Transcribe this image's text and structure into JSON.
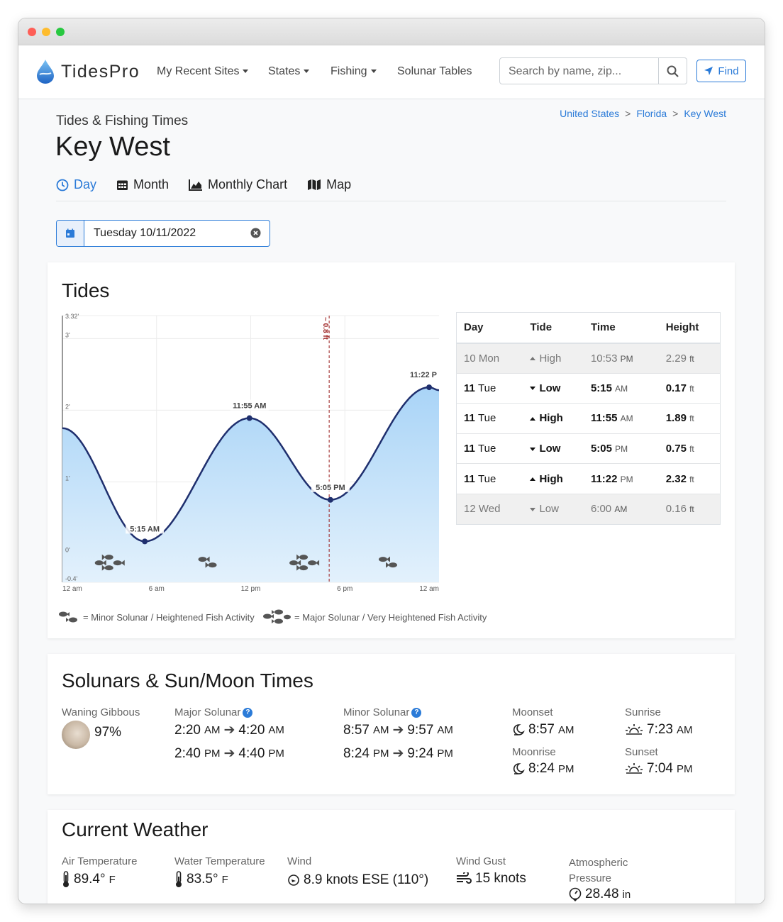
{
  "brand": {
    "name": "TidesPro"
  },
  "nav": {
    "items": [
      "My Recent Sites",
      "States",
      "Fishing",
      "Solunar Tables"
    ],
    "search_placeholder": "Search by name, zip...",
    "find_label": "Find"
  },
  "header": {
    "subtitle": "Tides & Fishing Times",
    "title": "Key West",
    "breadcrumb": [
      "United States",
      "Florida",
      "Key West"
    ]
  },
  "tabs": [
    {
      "label": "Day",
      "icon": "clock-icon",
      "active": true
    },
    {
      "label": "Month",
      "icon": "calendar-grid-icon"
    },
    {
      "label": "Monthly Chart",
      "icon": "area-chart-icon"
    },
    {
      "label": "Map",
      "icon": "map-icon"
    }
  ],
  "date": {
    "value": "Tuesday 10/11/2022"
  },
  "tides": {
    "title": "Tides",
    "table": {
      "headers": [
        "Day",
        "Tide",
        "Time",
        "Height"
      ],
      "rows": [
        {
          "day": "10 Mon",
          "tide": "High",
          "time": "10:53",
          "ampm": "PM",
          "height": "2.29",
          "unit": "ft",
          "style": "dim"
        },
        {
          "day_num": "11",
          "day_name": "Tue",
          "tide": "Low",
          "time": "5:15",
          "ampm": "AM",
          "height": "0.17",
          "unit": "ft",
          "style": "cur"
        },
        {
          "day_num": "11",
          "day_name": "Tue",
          "tide": "High",
          "time": "11:55",
          "ampm": "AM",
          "height": "1.89",
          "unit": "ft",
          "style": "cur"
        },
        {
          "day_num": "11",
          "day_name": "Tue",
          "tide": "Low",
          "time": "5:05",
          "ampm": "PM",
          "height": "0.75",
          "unit": "ft",
          "style": "cur"
        },
        {
          "day_num": "11",
          "day_name": "Tue",
          "tide": "High",
          "time": "11:22",
          "ampm": "PM",
          "height": "2.32",
          "unit": "ft",
          "style": "cur"
        },
        {
          "day": "12 Wed",
          "tide": "Low",
          "time": "6:00",
          "ampm": "AM",
          "height": "0.16",
          "unit": "ft",
          "style": "dim"
        }
      ]
    },
    "legend": {
      "minor": "= Minor Solunar / Heightened Fish Activity",
      "major": "= Major Solunar / Very Heightened Fish Activity"
    }
  },
  "chart_data": {
    "type": "area",
    "x_ticks": [
      "12 am",
      "6 am",
      "12 pm",
      "6 pm",
      "12 am"
    ],
    "y_ticks": [
      "-0.4'",
      "0'",
      "1'",
      "2'",
      "3'",
      "3.32'"
    ],
    "ylim": [
      -0.4,
      3.32
    ],
    "xlim_hours": [
      0,
      24
    ],
    "points": [
      {
        "time": "12:00 AM",
        "hour": 0,
        "height": 1.75
      },
      {
        "time": "5:15 AM",
        "hour": 5.25,
        "height": 0.17,
        "label": "5:15 AM"
      },
      {
        "time": "11:55 AM",
        "hour": 11.92,
        "height": 1.89,
        "label": "11:55 AM"
      },
      {
        "time": "5:05 PM",
        "hour": 17.08,
        "height": 0.75,
        "label": "5:05 PM"
      },
      {
        "time": "11:22 PM",
        "hour": 23.37,
        "height": 2.32,
        "label": "11:22 P"
      },
      {
        "time": "12:00 AM",
        "hour": 24,
        "height": 2.28
      }
    ],
    "now_marker": {
      "hour": 17.0,
      "label": "~ 0.8 ft"
    },
    "fish": [
      {
        "hour": 2.7,
        "type": "major"
      },
      {
        "hour": 9.2,
        "type": "minor"
      },
      {
        "hour": 15.1,
        "type": "major"
      },
      {
        "hour": 20.7,
        "type": "minor"
      }
    ],
    "colors": {
      "fill_top": "#a9d4f7",
      "fill_bottom": "#e3f1fc",
      "line": "#1f2f6e",
      "marker": "#9b1c1c"
    }
  },
  "solunar": {
    "title": "Solunars & Sun/Moon Times",
    "moon": {
      "label": "Waning Gibbous",
      "pct": "97%"
    },
    "major": {
      "label": "Major Solunar",
      "r1s": "2:20",
      "r1sa": "AM",
      "r1e": "4:20",
      "r1ea": "AM",
      "r2s": "2:40",
      "r2sa": "PM",
      "r2e": "4:40",
      "r2ea": "PM"
    },
    "minor": {
      "label": "Minor Solunar",
      "r1s": "8:57",
      "r1sa": "AM",
      "r1e": "9:57",
      "r1ea": "AM",
      "r2s": "8:24",
      "r2sa": "PM",
      "r2e": "9:24",
      "r2ea": "PM"
    },
    "moonset": {
      "label": "Moonset",
      "time": "8:57",
      "ampm": "AM"
    },
    "moonrise": {
      "label": "Moonrise",
      "time": "8:24",
      "ampm": "PM"
    },
    "sunrise": {
      "label": "Sunrise",
      "time": "7:23",
      "ampm": "AM"
    },
    "sunset": {
      "label": "Sunset",
      "time": "7:04",
      "ampm": "PM"
    }
  },
  "weather": {
    "title": "Current Weather",
    "air": {
      "label": "Air Temperature",
      "value": "89.4°",
      "unit": "F"
    },
    "water": {
      "label": "Water Temperature",
      "value": "83.5°",
      "unit": "F"
    },
    "wind": {
      "label": "Wind",
      "value": "8.9 knots ESE (110°)"
    },
    "gust": {
      "label": "Wind Gust",
      "value": "15 knots"
    },
    "pressure": {
      "label1": "Atmospheric",
      "label2": "Pressure",
      "value": "28.48",
      "unit": "in"
    }
  }
}
